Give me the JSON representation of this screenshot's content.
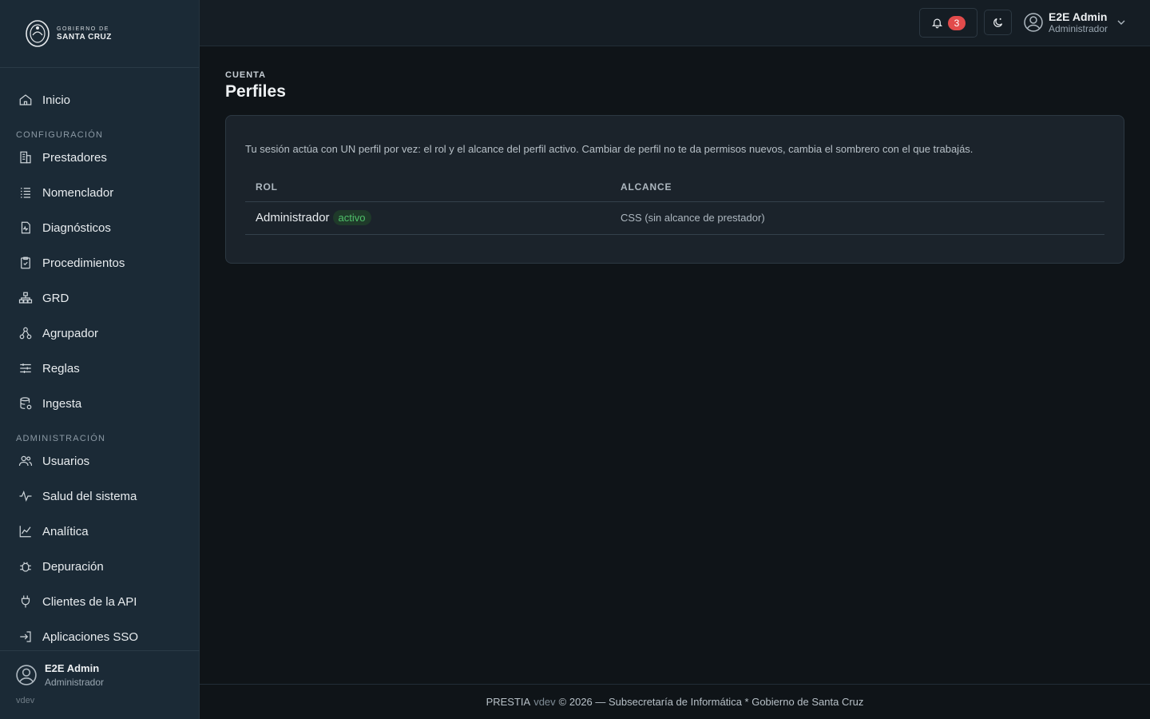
{
  "brand": {
    "line1": "GOBIERNO DE",
    "line2": "SANTA CRUZ"
  },
  "sidebar": {
    "home": {
      "label": "Inicio",
      "icon": "home-icon"
    },
    "sections": [
      {
        "title": "CONFIGURACIÓN",
        "items": [
          {
            "label": "Prestadores",
            "icon": "building-icon"
          },
          {
            "label": "Nomenclador",
            "icon": "list-icon"
          },
          {
            "label": "Diagnósticos",
            "icon": "file-pulse-icon"
          },
          {
            "label": "Procedimientos",
            "icon": "clipboard-check-icon"
          },
          {
            "label": "GRD",
            "icon": "hierarchy-icon"
          },
          {
            "label": "Agrupador",
            "icon": "group-icon"
          },
          {
            "label": "Reglas",
            "icon": "sliders-icon"
          },
          {
            "label": "Ingesta",
            "icon": "database-icon"
          }
        ]
      },
      {
        "title": "ADMINISTRACIÓN",
        "items": [
          {
            "label": "Usuarios",
            "icon": "users-icon"
          },
          {
            "label": "Salud del sistema",
            "icon": "activity-icon"
          },
          {
            "label": "Analítica",
            "icon": "chart-line-icon"
          },
          {
            "label": "Depuración",
            "icon": "bug-icon"
          },
          {
            "label": "Clientes de la API",
            "icon": "plug-icon"
          },
          {
            "label": "Aplicaciones SSO",
            "icon": "login-icon"
          }
        ]
      }
    ],
    "user": {
      "name": "E2E Admin",
      "role": "Administrador"
    },
    "version": "vdev"
  },
  "topbar": {
    "notifications_count": "3",
    "user": {
      "name": "E2E Admin",
      "role": "Administrador"
    }
  },
  "main": {
    "eyebrow": "CUENTA",
    "title": "Perfiles",
    "description": "Tu sesión actúa con UN perfil por vez: el rol y el alcance del perfil activo. Cambiar de perfil no te da permisos nuevos, cambia el sombrero con el que trabajás.",
    "table": {
      "headers": [
        "ROL",
        "ALCANCE"
      ],
      "rows": [
        {
          "role": "Administrador",
          "badge": "activo",
          "scope": "CSS (sin alcance de prestador)"
        }
      ]
    }
  },
  "footer": {
    "app": "PRESTIA",
    "version": "vdev",
    "text": "© 2026 — Subsecretaría de Informática * Gobierno de Santa Cruz"
  },
  "colors": {
    "accent_active": "#4fc06a",
    "badge_bg": "#e24b4b"
  }
}
